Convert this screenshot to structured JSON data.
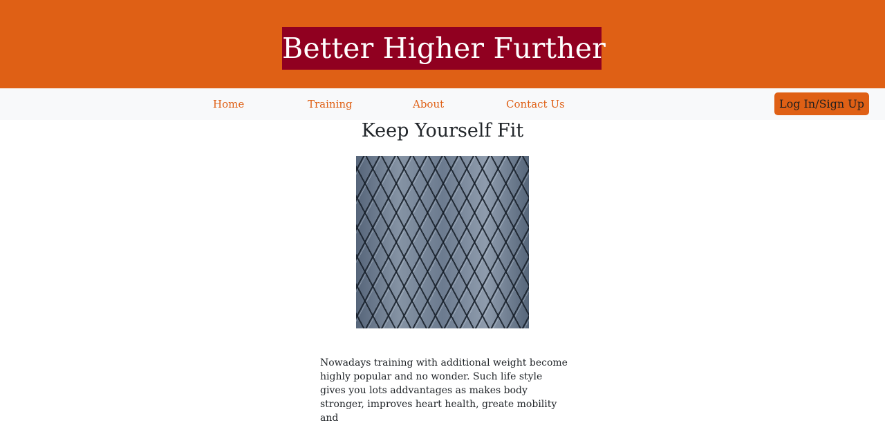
{
  "header": {
    "brand_title": "Better Higher Further"
  },
  "nav": {
    "items": [
      {
        "label": "Home"
      },
      {
        "label": "Training"
      },
      {
        "label": "About"
      },
      {
        "label": "Contact Us"
      }
    ],
    "login_label": "Log In/Sign Up"
  },
  "main": {
    "title": "Keep Yourself Fit",
    "image_icon": "diamond-plate-metal-image",
    "paragraph": "Nowadays training with additional weight become highly popular and no wonder. Such life style gives you lots addvantages as makes body stronger, improves heart health, greate mobility and"
  },
  "colors": {
    "header_bg": "#df6015",
    "brand_bg": "#900020",
    "nav_bg": "#f8f9fa",
    "accent": "#df6015",
    "text": "#212529"
  }
}
